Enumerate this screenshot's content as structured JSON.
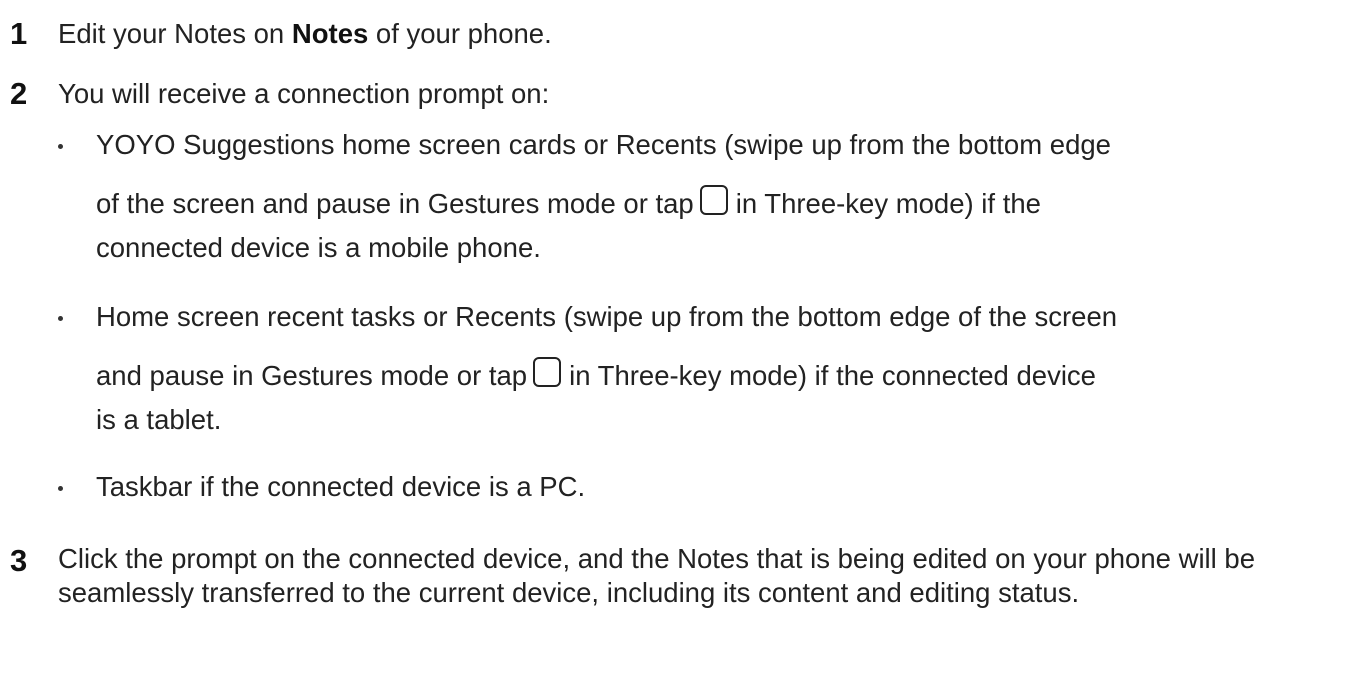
{
  "steps": [
    {
      "number": "1",
      "text_before": "Edit your Notes on ",
      "bold": "Notes",
      "text_after": " of your phone."
    },
    {
      "number": "2",
      "text": "You will receive a connection prompt on:"
    },
    {
      "number": "3",
      "text": "Click the prompt on the connected device, and the Notes that is being edited on your phone will be seamlessly transferred to the current device, including its content and editing status."
    }
  ],
  "bullets": [
    {
      "line1": "YOYO Suggestions home screen cards or Recents (swipe up from the bottom edge",
      "line2_before": "of the screen and pause in Gestures mode or tap",
      "line2_after": "in Three-key mode) if the",
      "line3": "connected device is a mobile phone.",
      "icon": "recents-key-icon"
    },
    {
      "line1": "Home screen recent tasks or Recents (swipe up from the bottom edge of the screen",
      "line2_before": "and pause in Gestures mode or tap",
      "line2_after": "in Three-key mode) if the connected device",
      "line3": "is a tablet.",
      "icon": "recents-key-icon"
    },
    {
      "line1": "Taskbar if the connected device is a PC."
    }
  ]
}
